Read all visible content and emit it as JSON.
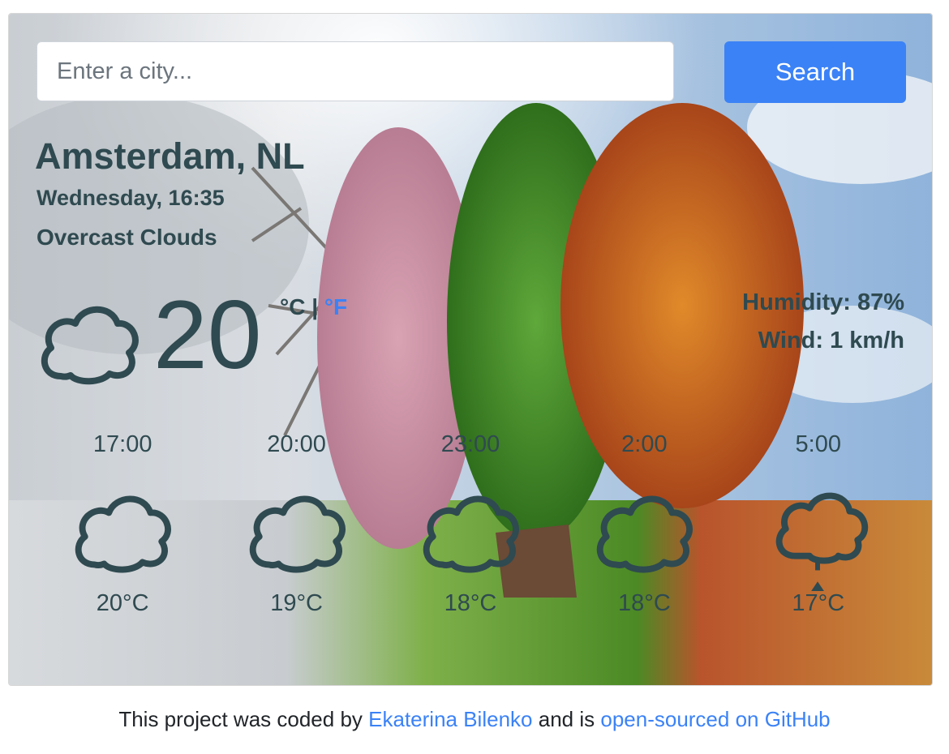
{
  "search": {
    "placeholder": "Enter a city...",
    "button_label": "Search"
  },
  "current": {
    "city": "Amsterdam, NL",
    "datetime": "Wednesday, 16:35",
    "description": "Overcast Clouds",
    "temperature": "20",
    "unit_celsius": "°C",
    "unit_separator": "|",
    "unit_fahrenheit": "°F",
    "humidity": "Humidity: 87%",
    "wind": "Wind: 1 km/h",
    "icon": "cloud-icon"
  },
  "forecast": [
    {
      "time": "17:00",
      "temp": "20°C",
      "icon": "cloud-icon"
    },
    {
      "time": "20:00",
      "temp": "19°C",
      "icon": "cloud-icon"
    },
    {
      "time": "23:00",
      "temp": "18°C",
      "icon": "cloud-icon"
    },
    {
      "time": "2:00",
      "temp": "18°C",
      "icon": "cloud-icon"
    },
    {
      "time": "5:00",
      "temp": "17°C",
      "icon": "cloud-rain-icon"
    }
  ],
  "footer": {
    "prefix": "This project was coded by",
    "author_link": "Ekaterina Bilenko",
    "middle": "and is",
    "github_link": "open-sourced on GitHub"
  },
  "colors": {
    "text": "#2f4a50",
    "accent": "#3b82f6",
    "sky": "#a9c4e2",
    "spring_green": "#4f9a2e",
    "autumn_orange": "#c46a1c"
  }
}
